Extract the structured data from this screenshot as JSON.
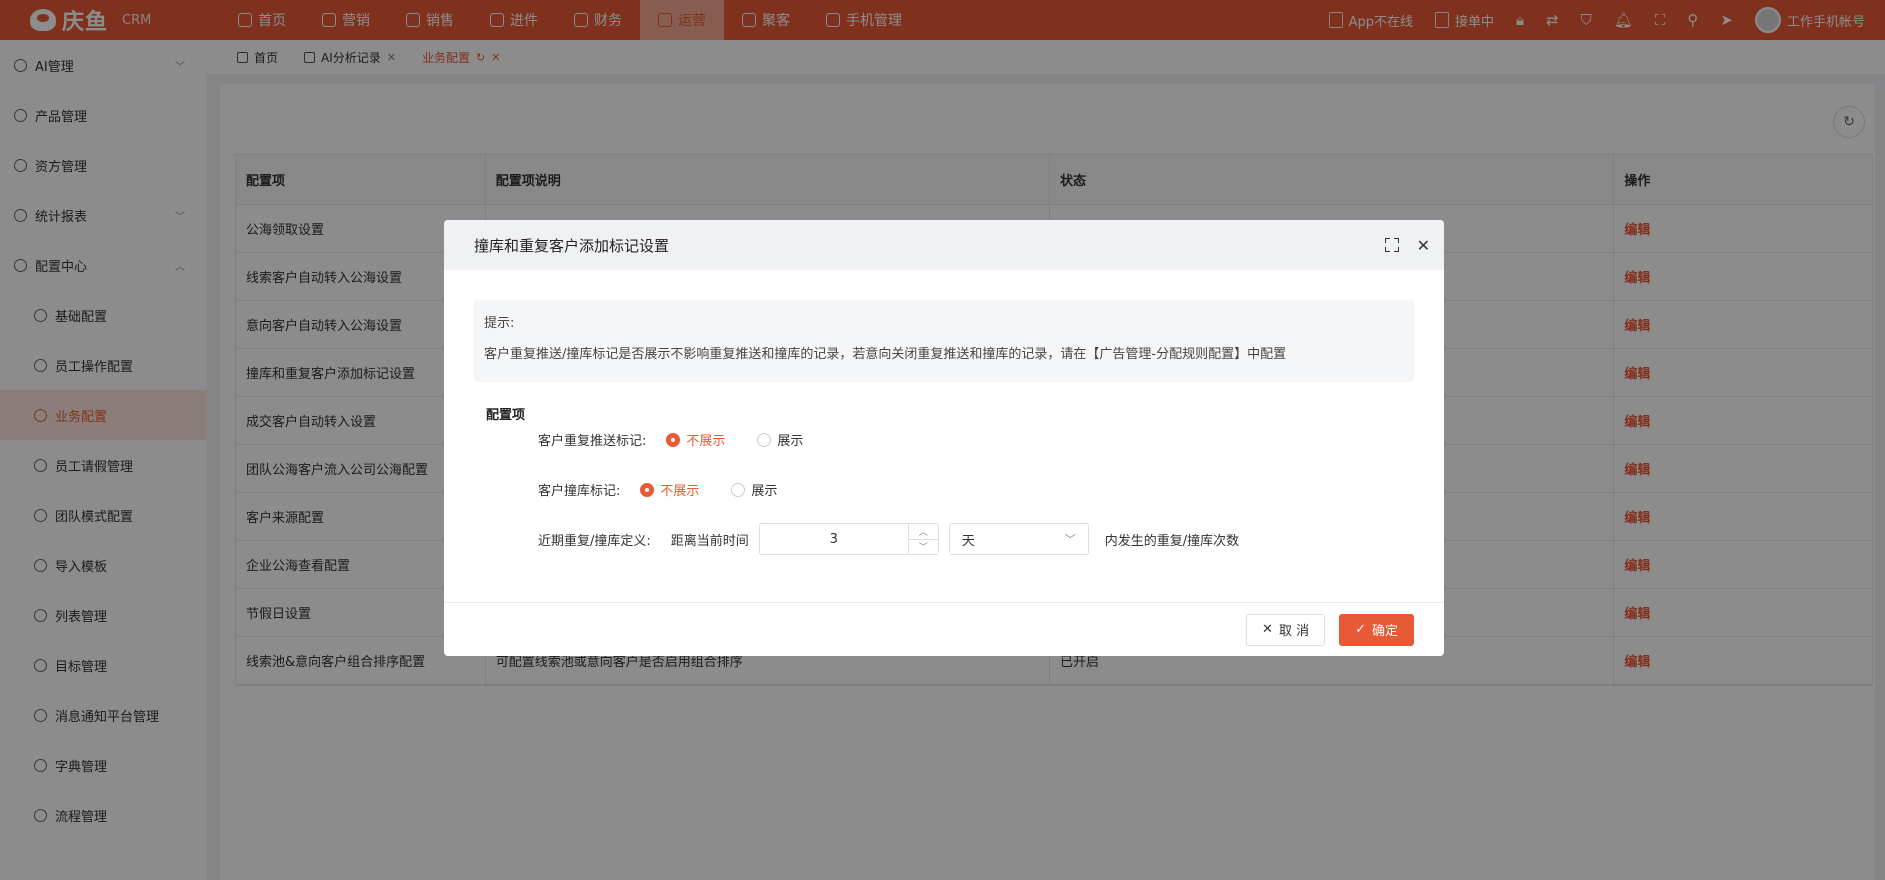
{
  "brand": {
    "name": "庆鱼",
    "suffix": "CRM"
  },
  "topnav": [
    {
      "label": "首页",
      "icon": "home-icon"
    },
    {
      "label": "营销",
      "icon": "marketing-icon"
    },
    {
      "label": "销售",
      "icon": "user-icon"
    },
    {
      "label": "进件",
      "icon": "document-icon"
    },
    {
      "label": "财务",
      "icon": "finance-icon"
    },
    {
      "label": "运营",
      "icon": "operations-icon",
      "active": true
    },
    {
      "label": "聚客",
      "icon": "customer-icon"
    },
    {
      "label": "手机管理",
      "icon": "phone-icon"
    }
  ],
  "topright": {
    "app_status": "App不在线",
    "order_status": "接单中",
    "account": "工作手机帐号"
  },
  "sidebar": [
    {
      "label": "AI管理",
      "icon": "ai-icon",
      "chevron": "down"
    },
    {
      "label": "产品管理",
      "icon": "product-icon"
    },
    {
      "label": "资方管理",
      "icon": "funder-icon"
    },
    {
      "label": "统计报表",
      "icon": "report-icon",
      "chevron": "down"
    },
    {
      "label": "配置中心",
      "icon": "config-icon",
      "chevron": "up"
    },
    {
      "label": "基础配置",
      "icon": "basic-config-icon",
      "sub": true
    },
    {
      "label": "员工操作配置",
      "icon": "staff-icon",
      "sub": true
    },
    {
      "label": "业务配置",
      "icon": "business-icon",
      "sub": true,
      "active": true
    },
    {
      "label": "员工请假管理",
      "icon": "leave-icon",
      "sub": true
    },
    {
      "label": "团队模式配置",
      "icon": "team-icon",
      "sub": true
    },
    {
      "label": "导入模板",
      "icon": "import-icon",
      "sub": true
    },
    {
      "label": "列表管理",
      "icon": "list-icon",
      "sub": true
    },
    {
      "label": "目标管理",
      "icon": "target-icon",
      "sub": true
    },
    {
      "label": "消息通知平台管理",
      "icon": "bell-icon",
      "sub": true
    },
    {
      "label": "字典管理",
      "icon": "dictionary-icon",
      "sub": true
    },
    {
      "label": "流程管理",
      "icon": "process-icon",
      "sub": true
    }
  ],
  "tabs": [
    {
      "label": "首页",
      "closable": false
    },
    {
      "label": "AI分析记录",
      "closable": true
    },
    {
      "label": "业务配置",
      "closable": true,
      "active": true
    }
  ],
  "table": {
    "headers": [
      "配置项",
      "配置项说明",
      "状态",
      "操作"
    ],
    "rows": [
      {
        "name": "公海领取设置",
        "desc": "",
        "status": "",
        "action": "编辑"
      },
      {
        "name": "线索客户自动转入公海设置",
        "desc": "",
        "status": "",
        "action": "编辑"
      },
      {
        "name": "意向客户自动转入公海设置",
        "desc": "",
        "status": "",
        "action": "编辑"
      },
      {
        "name": "撞库和重复客户添加标记设置",
        "desc": "",
        "status": "",
        "action": "编辑"
      },
      {
        "name": "成交客户自动转入设置",
        "desc": "",
        "status": "",
        "action": "编辑"
      },
      {
        "name": "团队公海客户流入公司公海配置",
        "desc": "",
        "status": "",
        "action": "编辑"
      },
      {
        "name": "客户来源配置",
        "desc": "",
        "status": "",
        "action": "编辑"
      },
      {
        "name": "企业公海查看配置",
        "desc": "",
        "status": "",
        "action": "编辑"
      },
      {
        "name": "节假日设置",
        "desc": "",
        "status": "",
        "action": "编辑"
      },
      {
        "name": "线索池&意向客户组合排序配置",
        "desc": "可配置线索池或意向客户是否启用组合排序",
        "status": "已开启",
        "action": "编辑"
      }
    ]
  },
  "modal": {
    "title": "撞库和重复客户添加标记设置",
    "tip_title": "提示:",
    "tip_text": "客户重复推送/撞库标记是否展示不影响重复推送和撞库的记录，若意向关闭重复推送和撞库的记录，请在【广告管理-分配规则配置】中配置",
    "section_title": "配置项",
    "repeat_push_label": "客户重复推送标记:",
    "hit_label": "客户撞库标记:",
    "option_hide": "不展示",
    "option_show": "展示",
    "repeat_push_value": "不展示",
    "hit_value": "不展示",
    "recent_label": "近期重复/撞库定义:",
    "distance_label": "距离当前时间",
    "distance_value": "3",
    "unit_value": "天",
    "suffix_text": "内发生的重复/撞库次数",
    "cancel_label": "取 消",
    "ok_label": "确定"
  },
  "colors": {
    "accent": "#e85a36",
    "active_tab_bg": "#f7a994"
  }
}
